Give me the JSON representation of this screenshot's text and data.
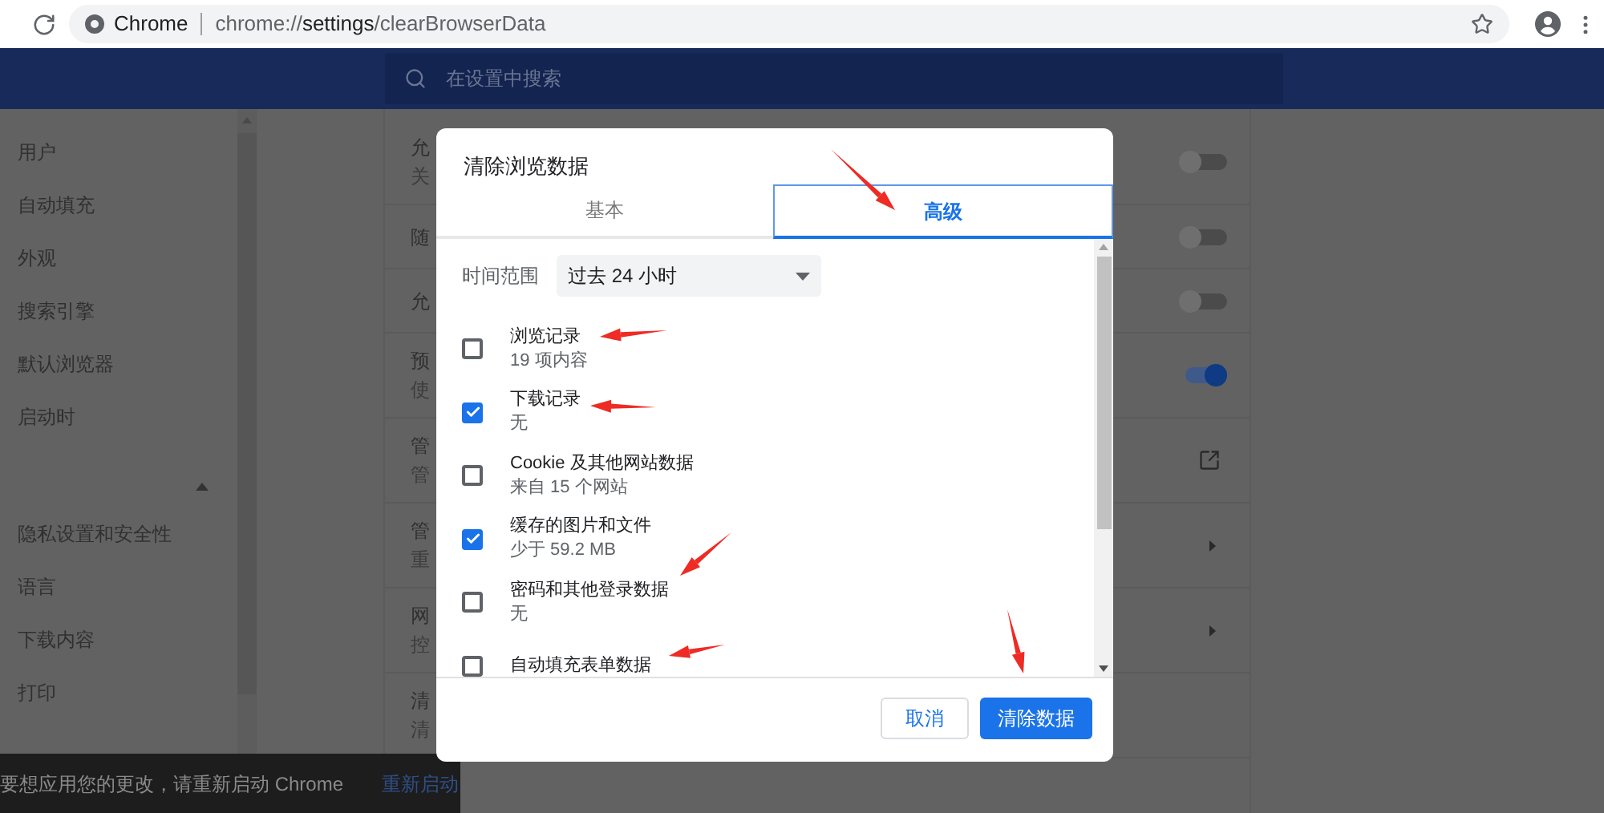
{
  "browser": {
    "site_label": "Chrome",
    "url": "chrome://**settings**/clearBrowserData"
  },
  "search": {
    "placeholder": "在设置中搜索"
  },
  "sidebar": {
    "items": [
      {
        "label": "用户",
        "kind": "item"
      },
      {
        "label": "自动填充",
        "kind": "item"
      },
      {
        "label": "外观",
        "kind": "item"
      },
      {
        "label": "搜索引擎",
        "kind": "item"
      },
      {
        "label": "默认浏览器",
        "kind": "item"
      },
      {
        "label": "启动时",
        "kind": "item"
      },
      {
        "kind": "collapse"
      },
      {
        "label": "隐私设置和安全性",
        "kind": "item"
      },
      {
        "label": "语言",
        "kind": "item"
      },
      {
        "label": "下载内容",
        "kind": "item"
      },
      {
        "label": "打印",
        "kind": "item"
      }
    ]
  },
  "settings_rows": [
    {
      "title": "允",
      "subtitle": "关",
      "kind": "toggle",
      "on": false
    },
    {
      "title": "随",
      "kind": "toggle",
      "on": false
    },
    {
      "title": "允",
      "kind": "toggle",
      "on": false
    },
    {
      "title": "预",
      "subtitle": "使",
      "kind": "toggle",
      "on": true
    },
    {
      "title": "管",
      "subtitle": "管",
      "kind": "external"
    },
    {
      "title": "管",
      "subtitle": "重",
      "kind": "arrow"
    },
    {
      "title": "网",
      "subtitle": "控",
      "kind": "arrow"
    },
    {
      "title": "清",
      "subtitle": "清",
      "kind": "none"
    }
  ],
  "dialog": {
    "title": "清除浏览数据",
    "tabs": [
      {
        "label": "基本",
        "selected": false
      },
      {
        "label": "高级",
        "selected": true
      }
    ],
    "time_range": {
      "label": "时间范围",
      "value": "过去 24 小时"
    },
    "items": [
      {
        "title": "浏览记录",
        "subtitle": "19 项内容",
        "checked": false
      },
      {
        "title": "下载记录",
        "subtitle": "无",
        "checked": true
      },
      {
        "title": "Cookie 及其他网站数据",
        "subtitle": "来自 15 个网站",
        "checked": false
      },
      {
        "title": "缓存的图片和文件",
        "subtitle": "少于 59.2 MB",
        "checked": true
      },
      {
        "title": "密码和其他登录数据",
        "subtitle": "无",
        "checked": false
      },
      {
        "title": "自动填充表单数据",
        "checked": false
      }
    ],
    "buttons": [
      {
        "label": "取消",
        "kind": "secondary"
      },
      {
        "label": "清除数据",
        "kind": "primary"
      }
    ]
  },
  "snackbar": {
    "message": "要想应用您的更改，请重新启动 Chrome",
    "action": "重新启动"
  }
}
